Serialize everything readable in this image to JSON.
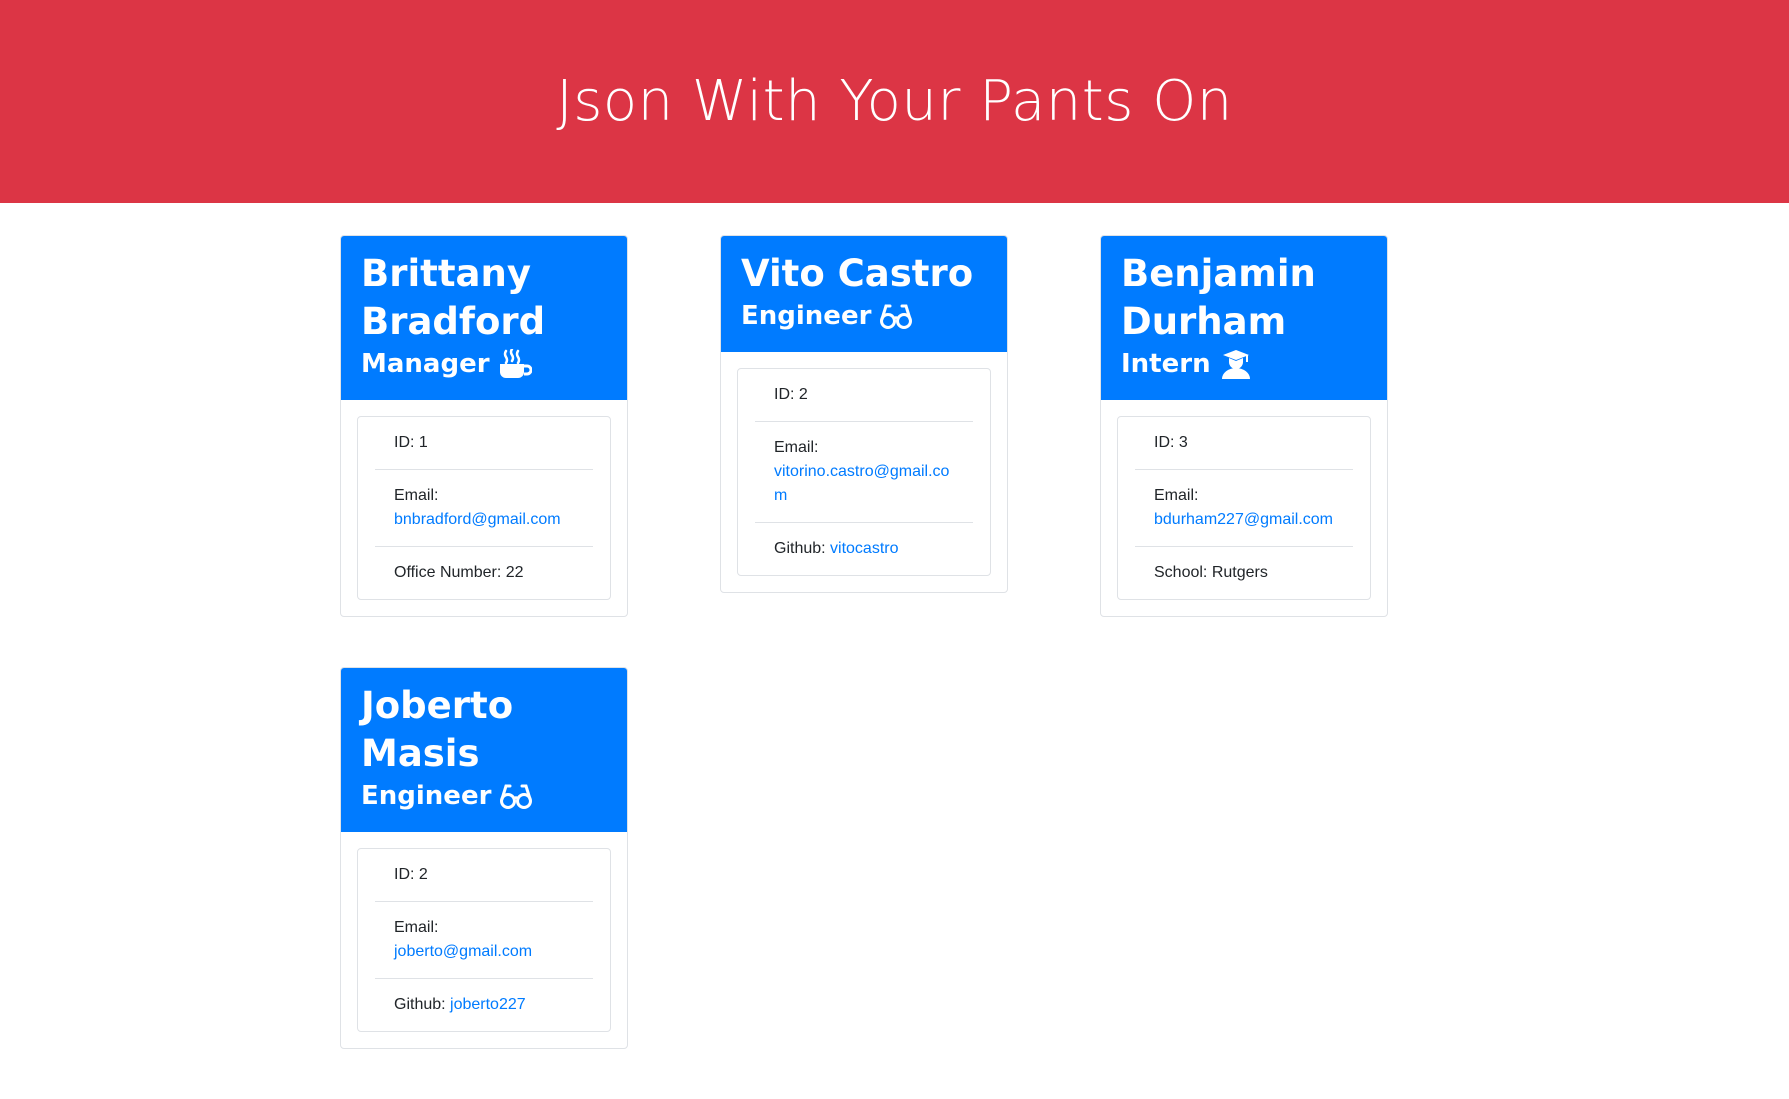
{
  "header": {
    "title": "Json With Your Pants On"
  },
  "colors": {
    "banner": "#dc3545",
    "card_header": "#007bff",
    "link": "#007bff"
  },
  "employees": [
    {
      "name": "Brittany Bradford",
      "role": "Manager",
      "icon": "coffee-mug-icon",
      "id_text": "ID: 1",
      "email_label": "Email:",
      "email": "bnbradford@gmail.com",
      "extra_label": "Office Number: 22",
      "extra_value": ""
    },
    {
      "name": "Vito Castro",
      "role": "Engineer",
      "icon": "glasses-icon",
      "id_text": "ID: 2",
      "email_label": "Email:",
      "email": "vitorino.castro@gmail.com",
      "extra_label": "Github: ",
      "extra_value": "vitocastro"
    },
    {
      "name": "Benjamin Durham",
      "role": "Intern",
      "icon": "graduate-icon",
      "id_text": "ID: 3",
      "email_label": "Email:",
      "email": "bdurham227@gmail.com",
      "extra_label": "School: Rutgers",
      "extra_value": ""
    },
    {
      "name": "Joberto Masis",
      "role": "Engineer",
      "icon": "glasses-icon",
      "id_text": "ID: 2",
      "email_label": "Email:",
      "email": "joberto@gmail.com",
      "extra_label": "Github: ",
      "extra_value": "joberto227"
    }
  ]
}
